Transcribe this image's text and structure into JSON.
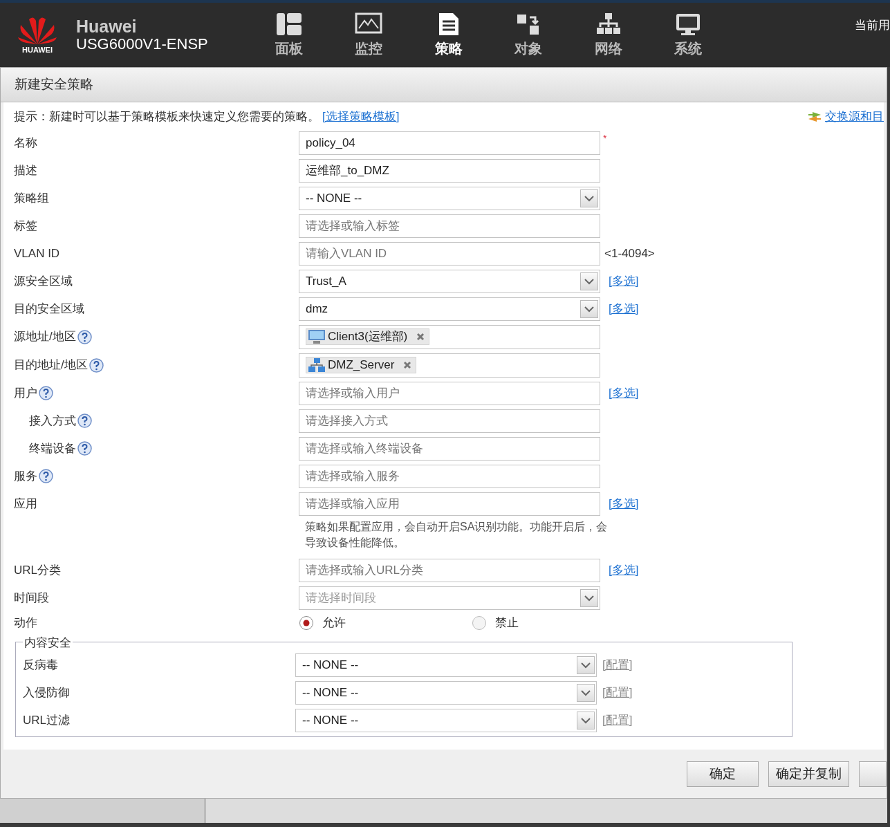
{
  "header": {
    "brand": "Huawei",
    "logo_text": "HUAWEI",
    "model": "USG6000V1-ENSP",
    "user_label": "当前用",
    "nav": [
      {
        "label": "面板",
        "selected": false
      },
      {
        "label": "监控",
        "selected": false
      },
      {
        "label": "策略",
        "selected": true
      },
      {
        "label": "对象",
        "selected": false
      },
      {
        "label": "网络",
        "selected": false
      },
      {
        "label": "系统",
        "selected": false
      }
    ]
  },
  "dialog": {
    "title": "新建安全策略",
    "hint": {
      "text": "提示：新建时可以基于策略模板来快速定义您需要的策略。",
      "link": "[选择策略模板]"
    },
    "swap_link": "交换源和目",
    "rows": [
      {
        "kind": "text",
        "label": "名称",
        "value": "policy_04",
        "required_mark": "*"
      },
      {
        "kind": "text",
        "label": "描述",
        "value": "运维部_to_DMZ"
      },
      {
        "kind": "select",
        "label": "策略组",
        "value": "-- NONE --"
      },
      {
        "kind": "text",
        "label": "标签",
        "placeholder": "请选择或输入标签"
      },
      {
        "kind": "text",
        "label": "VLAN ID",
        "placeholder": "请输入VLAN ID",
        "suffix": "<1-4094>"
      },
      {
        "kind": "select",
        "label": "源安全区域",
        "value": "Trust_A",
        "link": "[多选]"
      },
      {
        "kind": "select",
        "label": "目的安全区域",
        "value": "dmz",
        "link": "[多选]"
      },
      {
        "kind": "tags",
        "label": "源地址/地区",
        "help": true,
        "tags": [
          {
            "text": "Client3(运维部)"
          }
        ]
      },
      {
        "kind": "tags",
        "label": "目的地址/地区",
        "help": true,
        "tags": [
          {
            "text": "DMZ_Server"
          }
        ]
      },
      {
        "kind": "text",
        "label": "用户",
        "help": true,
        "placeholder": "请选择或输入用户",
        "link": "[多选]"
      },
      {
        "kind": "text",
        "label": "接入方式",
        "help": true,
        "indent": true,
        "placeholder": "请选择接入方式"
      },
      {
        "kind": "text",
        "label": "终端设备",
        "help": true,
        "indent": true,
        "placeholder": "请选择或输入终端设备"
      },
      {
        "kind": "text",
        "label": "服务",
        "help": true,
        "placeholder": "请选择或输入服务"
      },
      {
        "kind": "text",
        "label": "应用",
        "placeholder": "请选择或输入应用",
        "link": "[多选]",
        "note": "策略如果配置应用，会自动开启SA识别功能。功能开启后，会导致设备性能降低。"
      },
      {
        "kind": "text",
        "label": "URL分类",
        "placeholder": "请选择或输入URL分类",
        "link": "[多选]"
      },
      {
        "kind": "select",
        "label": "时间段",
        "placeholder": "请选择时间段"
      },
      {
        "kind": "radio",
        "label": "动作",
        "options": [
          {
            "label": "允许",
            "selected": true
          },
          {
            "label": "禁止",
            "selected": false
          }
        ]
      }
    ],
    "content_security": {
      "legend": "内容安全",
      "rows": [
        {
          "label": "反病毒",
          "value": "-- NONE --",
          "link": "[配置]"
        },
        {
          "label": "入侵防御",
          "value": "-- NONE --",
          "link": "[配置]"
        },
        {
          "label": "URL过滤",
          "value": "-- NONE --",
          "link": "[配置]"
        }
      ]
    },
    "buttons": [
      {
        "label": "确定"
      },
      {
        "label": "确定并复制"
      }
    ],
    "cut_off_button": true
  }
}
